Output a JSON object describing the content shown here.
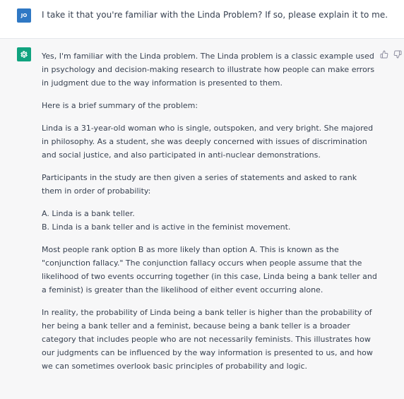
{
  "user_message": {
    "avatar_initials": "JO",
    "text": "I take it that you're familiar with the Linda Problem? If so, please explain it to me."
  },
  "assistant_message": {
    "paragraphs": [
      "Yes, I'm familiar with the Linda problem. The Linda problem is a classic example used in psychology and decision-making research to illustrate how people can make errors in judgment due to the way information is presented to them.",
      "Here is a brief summary of the problem:",
      "Linda is a 31-year-old woman who is single, outspoken, and very bright. She majored in philosophy. As a student, she was deeply concerned with issues of discrimination and social justice, and also participated in anti-nuclear demonstrations.",
      "Participants in the study are then given a series of statements and asked to rank them in order of probability:"
    ],
    "options": [
      "A. Linda is a bank teller.",
      "B. Linda is a bank teller and is active in the feminist movement."
    ],
    "paragraphs_after": [
      "Most people rank option B as more likely than option A. This is known as the \"conjunction fallacy.\" The conjunction fallacy occurs when people assume that the likelihood of two events occurring together (in this case, Linda being a bank teller and a feminist) is greater than the likelihood of either event occurring alone.",
      "In reality, the probability of Linda being a bank teller is higher than the probability of her being a bank teller and a feminist, because being a bank teller is a broader category that includes people who are not necessarily feminists. This illustrates how our judgments can be influenced by the way information is presented to us, and how we can sometimes overlook basic principles of probability and logic."
    ]
  },
  "icons": {
    "bot_avatar": "openai-logo-icon",
    "thumbs_up": "thumbs-up-icon",
    "thumbs_down": "thumbs-down-icon"
  },
  "colors": {
    "user_avatar_bg": "#2f78c4",
    "bot_avatar_bg": "#10a37f",
    "assistant_row_bg": "#f7f7f8",
    "text": "#374151"
  }
}
